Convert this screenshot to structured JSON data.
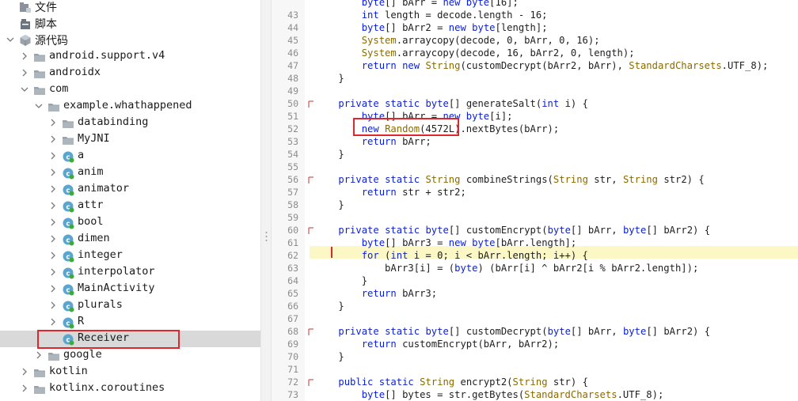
{
  "tree": {
    "items": [
      {
        "label": "文件",
        "icon": "folder-file-icon",
        "expandable": false,
        "selected": false
      },
      {
        "label": "脚本",
        "icon": "script-file-icon",
        "expandable": false,
        "selected": false
      },
      {
        "label": "源代码",
        "icon": "source-code-icon",
        "expandable": true,
        "expanded": true,
        "selected": false
      },
      {
        "label": "android.support.v4",
        "icon": "package-icon",
        "expandable": true,
        "expanded": false
      },
      {
        "label": "androidx",
        "icon": "package-icon",
        "expandable": true,
        "expanded": false
      },
      {
        "label": "com",
        "icon": "package-icon",
        "expandable": true,
        "expanded": true
      },
      {
        "label": "example.whathappened",
        "icon": "package-icon",
        "expandable": true,
        "expanded": true
      },
      {
        "label": "databinding",
        "icon": "package-icon",
        "expandable": true,
        "expanded": false
      },
      {
        "label": "MyJNI",
        "icon": "package-icon",
        "expandable": true,
        "expanded": false
      },
      {
        "label": "a",
        "icon": "class-icon",
        "expandable": true,
        "expanded": false
      },
      {
        "label": "anim",
        "icon": "class-icon",
        "expandable": true,
        "expanded": false
      },
      {
        "label": "animator",
        "icon": "class-icon",
        "expandable": true,
        "expanded": false
      },
      {
        "label": "attr",
        "icon": "class-icon",
        "expandable": true,
        "expanded": false
      },
      {
        "label": "bool",
        "icon": "class-icon",
        "expandable": true,
        "expanded": false
      },
      {
        "label": "dimen",
        "icon": "class-icon",
        "expandable": true,
        "expanded": false
      },
      {
        "label": "integer",
        "icon": "class-icon",
        "expandable": true,
        "expanded": false
      },
      {
        "label": "interpolator",
        "icon": "class-icon",
        "expandable": true,
        "expanded": false
      },
      {
        "label": "MainActivity",
        "icon": "class-icon",
        "expandable": true,
        "expanded": false
      },
      {
        "label": "plurals",
        "icon": "class-icon",
        "expandable": true,
        "expanded": false
      },
      {
        "label": "R",
        "icon": "class-icon",
        "expandable": true,
        "expanded": false
      },
      {
        "label": "Receiver",
        "icon": "class-icon",
        "expandable": false,
        "selected": true
      },
      {
        "label": "google",
        "icon": "package-icon",
        "expandable": true,
        "expanded": false
      },
      {
        "label": "kotlin",
        "icon": "package-icon",
        "expandable": true,
        "expanded": false
      },
      {
        "label": "kotlinx.coroutines",
        "icon": "package-icon",
        "expandable": true,
        "expanded": false
      }
    ]
  },
  "editor": {
    "breakpoint_line": "62",
    "lines": [
      {
        "n": "",
        "t": "        byte[] bArr = new byte[16];"
      },
      {
        "n": "43",
        "t": "        int length = decode.length - 16;"
      },
      {
        "n": "44",
        "t": "        byte[] bArr2 = new byte[length];"
      },
      {
        "n": "45",
        "t": "        System.arraycopy(decode, 0, bArr, 0, 16);"
      },
      {
        "n": "46",
        "t": "        System.arraycopy(decode, 16, bArr2, 0, length);"
      },
      {
        "n": "47",
        "t": "        return new String(customDecrypt(bArr2, bArr), StandardCharsets.UTF_8);"
      },
      {
        "n": "48",
        "t": "    }"
      },
      {
        "n": "49",
        "t": ""
      },
      {
        "n": "50",
        "t": "    private static byte[] generateSalt(int i) {"
      },
      {
        "n": "51",
        "t": "        byte[] bArr = new byte[i];"
      },
      {
        "n": "52",
        "t": "        new Random(4572L).nextBytes(bArr);"
      },
      {
        "n": "53",
        "t": "        return bArr;"
      },
      {
        "n": "54",
        "t": "    }"
      },
      {
        "n": "55",
        "t": ""
      },
      {
        "n": "56",
        "t": "    private static String combineStrings(String str, String str2) {"
      },
      {
        "n": "57",
        "t": "        return str + str2;"
      },
      {
        "n": "58",
        "t": "    }"
      },
      {
        "n": "59",
        "t": ""
      },
      {
        "n": "60",
        "t": "    private static byte[] customEncrypt(byte[] bArr, byte[] bArr2) {"
      },
      {
        "n": "61",
        "t": "        byte[] bArr3 = new byte[bArr.length];"
      },
      {
        "n": "62",
        "t": "        for (int i = 0; i < bArr.length; i++) {"
      },
      {
        "n": "63",
        "t": "            bArr3[i] = (byte) (bArr[i] ^ bArr2[i % bArr2.length]);"
      },
      {
        "n": "64",
        "t": "        }"
      },
      {
        "n": "65",
        "t": "        return bArr3;"
      },
      {
        "n": "66",
        "t": "    }"
      },
      {
        "n": "67",
        "t": ""
      },
      {
        "n": "68",
        "t": "    private static byte[] customDecrypt(byte[] bArr, byte[] bArr2) {"
      },
      {
        "n": "69",
        "t": "        return customEncrypt(bArr, bArr2);"
      },
      {
        "n": "70",
        "t": "    }"
      },
      {
        "n": "71",
        "t": ""
      },
      {
        "n": "72",
        "t": "    public static String encrypt2(String str) {"
      },
      {
        "n": "73",
        "t": "        byte[] bytes = str.getBytes(StandardCharsets.UTF_8);"
      },
      {
        "n": "",
        "t": ""
      }
    ]
  },
  "colors": {
    "highlight_box": "#e0262d",
    "keyword": "#0b1fd6",
    "type": "#8a6a00",
    "selected_row": "#d9d9d9",
    "current_line": "#fbf8c6"
  }
}
